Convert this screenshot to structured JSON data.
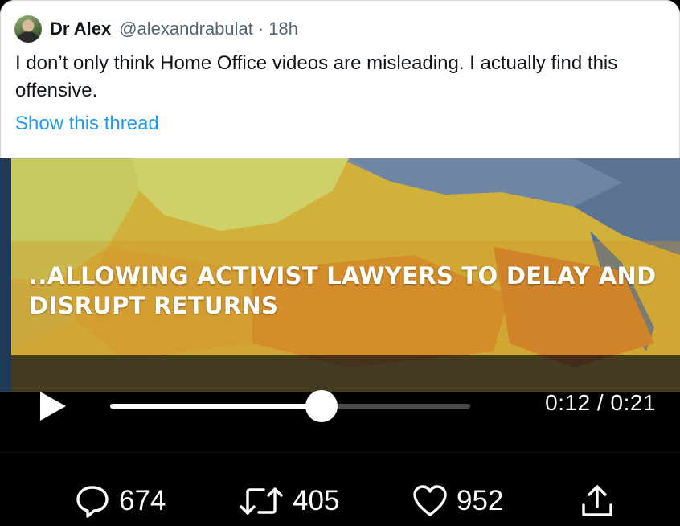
{
  "tweet": {
    "author_name": "Dr Alex",
    "handle": "@alexandrabulat",
    "separator": "·",
    "time": "18h",
    "text": "I don’t only think Home Office videos are misleading. I actually find this offensive.",
    "show_thread_label": "Show this thread"
  },
  "video": {
    "caption": "..ALLOWING ACTIVIST LAWYERS TO DELAY AND DISRUPT RETURNS",
    "current_time": "0:12",
    "duration": "0:21",
    "time_readout": "0:12 / 0:21",
    "progress_fraction": 0.588
  },
  "actions": {
    "reply_count": "674",
    "retweet_count": "405",
    "like_count": "952"
  },
  "icons": {
    "reply": "reply-icon",
    "retweet": "retweet-icon",
    "like": "heart-icon",
    "share": "share-icon",
    "play": "play-icon"
  },
  "colors": {
    "link": "#1d9bf0",
    "text": "#0f1419",
    "muted": "#536471"
  }
}
